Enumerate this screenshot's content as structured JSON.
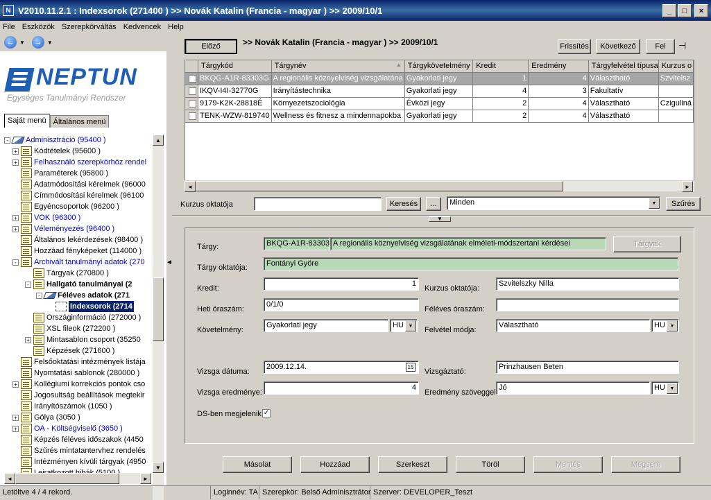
{
  "window": {
    "title": "V2010.11.2.1 : Indexsorok (271400  )  >> Novák Katalin (Francia - magyar ) >> 2009/10/1",
    "app_icon_label": "N",
    "minimize": "_",
    "maximize": "□",
    "close": "×"
  },
  "menu": [
    "File",
    "Eszközök",
    "Szerepkörváltás",
    "Kedvencek",
    "Help"
  ],
  "nav": {
    "back": "←",
    "forward": "→",
    "caret": "▼"
  },
  "logo": {
    "brand": "NEPTUN",
    "subtitle": "Egységes Tanulmányi Rendszer"
  },
  "tabs": [
    "Saját menü",
    "Általános menü"
  ],
  "tree": [
    {
      "label": "Adminisztráció (95400  )",
      "pm": "-",
      "icon": "book",
      "style": "blue"
    },
    {
      "label": "Kódtételek (95600  )",
      "pm": "+",
      "icon": "doc",
      "style": ""
    },
    {
      "label": "Felhasználó szerepkörhöz rendel",
      "pm": "+",
      "icon": "doc",
      "style": "blue"
    },
    {
      "label": "Paraméterek (95800  )",
      "pm": "",
      "icon": "doc",
      "style": ""
    },
    {
      "label": "Adatmódosítási kérelmek (96000",
      "pm": "",
      "icon": "doc",
      "style": ""
    },
    {
      "label": "Címmódosítási kérelmek (96100",
      "pm": "",
      "icon": "doc",
      "style": ""
    },
    {
      "label": "Egyéncsoportok (96200  )",
      "pm": "",
      "icon": "doc",
      "style": ""
    },
    {
      "label": "VOK (96300  )",
      "pm": "+",
      "icon": "doc",
      "style": "blue"
    },
    {
      "label": "Véleményezés (96400  )",
      "pm": "+",
      "icon": "doc",
      "style": "blue"
    },
    {
      "label": "Általános lekérdezések (98400  )",
      "pm": "",
      "icon": "doc",
      "style": ""
    },
    {
      "label": "Hozzáad fényképeket (114000  )",
      "pm": "",
      "icon": "doc",
      "style": ""
    },
    {
      "label": "Archivált tanulmányi adatok (270",
      "pm": "-",
      "icon": "doc",
      "style": "blue"
    },
    {
      "label": "Tárgyak (270800  )",
      "pm": "",
      "icon": "doc",
      "style": ""
    },
    {
      "label": "Hallgató tanulmányai (2",
      "pm": "-",
      "icon": "doc",
      "style": "bold"
    },
    {
      "label": "Féléves adatok (271",
      "pm": "-",
      "icon": "book",
      "style": "bold"
    },
    {
      "label": "Indexsorok (2714",
      "pm": "",
      "icon": "fold",
      "style": "sel"
    },
    {
      "label": "Országinformáció (272000  )",
      "pm": "",
      "icon": "doc",
      "style": ""
    },
    {
      "label": "XSL fileok (272200  )",
      "pm": "",
      "icon": "doc",
      "style": ""
    },
    {
      "label": "Mintasablon csoport (35250",
      "pm": "+",
      "icon": "doc",
      "style": ""
    },
    {
      "label": "Képzések (271600  )",
      "pm": "",
      "icon": "doc",
      "style": ""
    },
    {
      "label": "Felsőoktatási intézmények listája",
      "pm": "",
      "icon": "doc",
      "style": ""
    },
    {
      "label": "Nyomtatási sablonok (280000  )",
      "pm": "",
      "icon": "doc",
      "style": ""
    },
    {
      "label": "Kollégiumi korrekciós pontok cso",
      "pm": "+",
      "icon": "doc",
      "style": ""
    },
    {
      "label": "Jogosultság beállítások megtekir",
      "pm": "",
      "icon": "doc",
      "style": ""
    },
    {
      "label": "Irányítószámok (1050  )",
      "pm": "",
      "icon": "doc",
      "style": ""
    },
    {
      "label": "Gólya (3050  )",
      "pm": "+",
      "icon": "doc",
      "style": ""
    },
    {
      "label": "OA - Költségviselő (3650  )",
      "pm": "+",
      "icon": "doc",
      "style": "blue"
    },
    {
      "label": "Képzés féléves időszakok (4450",
      "pm": "",
      "icon": "doc",
      "style": ""
    },
    {
      "label": "Szűrés mintatantervhez rendelés",
      "pm": "",
      "icon": "doc",
      "style": ""
    },
    {
      "label": "Intézményen kívüli tárgyak (4950",
      "pm": "",
      "icon": "doc",
      "style": ""
    },
    {
      "label": "Leiratkozott hibák (5100  )",
      "pm": "",
      "icon": "doc",
      "style": ""
    }
  ],
  "toolbar": {
    "prev": "Előző",
    "breadcrumb": ">> Novák Katalin (Francia - magyar ) >> 2009/10/1",
    "refresh": "Frissítés",
    "next": "Következő",
    "up": "Fel",
    "pin": "⊣"
  },
  "grid": {
    "columns": [
      "Tárgykód",
      "Tárgynév",
      "Tárgykövetelmény",
      "Kredit",
      "Eredmény",
      "Tárgyfelvétel típusa",
      "Kurzus o"
    ],
    "sort_indicator": "▲",
    "rows": [
      [
        "BKQG-A1R-83303G",
        "A regionális köznyelviség vizsgálatána",
        "Gyakorlati jegy",
        "1",
        "4",
        "Választható",
        "Szvitelsz"
      ],
      [
        "IKQV-I4I-32770G",
        "Irányítástechnika",
        "Gyakorlati jegy",
        "4",
        "3",
        "Fakultatív",
        ""
      ],
      [
        "9179-K2K-28818É",
        "Környezetszociológia",
        "Évközi jegy",
        "2",
        "4",
        "Választható",
        "Cziguliná"
      ],
      [
        "TENK-WZW-819740",
        "Wellness és fitnesz a mindennapokba",
        "Gyakorlati jegy",
        "2",
        "4",
        "Választható",
        ""
      ]
    ]
  },
  "filter": {
    "label": "Kurzus oktatója",
    "value": "",
    "search": "Keresés",
    "ellipsis": "...",
    "scope": "Minden",
    "apply": "Szűrés"
  },
  "detail": {
    "subject_label": "Tárgy:",
    "subject_code": "BKQG-A1R-83303",
    "subject_name": "A regionális köznyelviség vizsgálatának elméleti-módszertani kérdései",
    "subjects_btn": "Tárgyak",
    "teacher_label": "Tárgy oktatója:",
    "teacher": "Fontányi Györe",
    "credit_label": "Kredit:",
    "credit": "1",
    "course_teacher_label": "Kurzus oktatója:",
    "course_teacher": "Szvitelszky Nilla",
    "weekly_label": "Heti óraszám:",
    "weekly": "0/1/0",
    "semester_hours_label": "Féléves óraszám:",
    "semester_hours": "",
    "requirement_label": "Követelmény:",
    "requirement": "Gyakorlati jegy",
    "lang1": "HU",
    "enroll_label": "Felvétel módja:",
    "enroll": "Választható",
    "lang2": "HU",
    "exam_date_label": "Vizsga dátuma:",
    "exam_date": "2009.12.14.",
    "cal": "15",
    "examiner_label": "Vizsgáztató:",
    "examiner": "Prinzhausen Beten",
    "exam_result_label": "Vizsga eredménye:",
    "exam_result": "4",
    "result_text_label": "Eredmény szöveggel:",
    "result_text": "Jó",
    "lang3": "HU",
    "ds_label": "DS-ben megjelenik",
    "ds_check": "✓"
  },
  "actions": {
    "copy": "Másolat",
    "add": "Hozzáad",
    "edit": "Szerkeszt",
    "delete": "Töröl",
    "save": "Mentés",
    "cancel": "Mégsem"
  },
  "status": {
    "loaded": "Letöltve 4 / 4 rekord.",
    "login": "Loginnév: TA",
    "role": "Szerepkör: Belső Adminisztrátor",
    "server": "Szerver: DEVELOPER_Teszt"
  }
}
